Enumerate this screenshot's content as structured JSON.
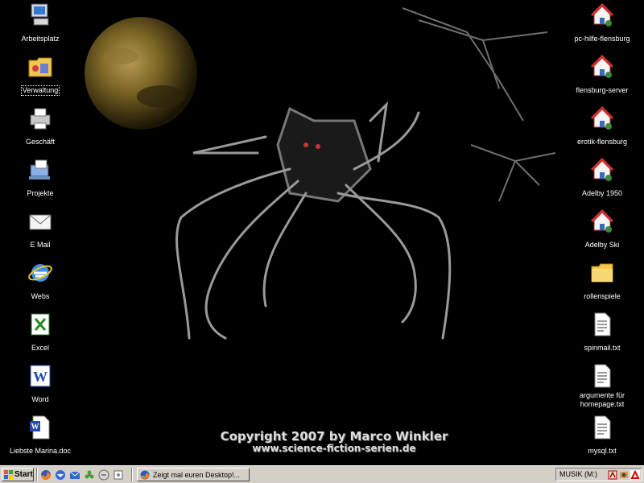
{
  "desktop": {
    "left_icons": [
      {
        "label": "Arbeitsplatz",
        "icon": "my-computer-icon"
      },
      {
        "label": "Verwaltung",
        "icon": "control-panel-folder-icon",
        "selected": true
      },
      {
        "label": "Geschäft",
        "icon": "printer-icon"
      },
      {
        "label": "Projekte",
        "icon": "projects-icon"
      },
      {
        "label": "E Mail",
        "icon": "email-envelope-icon"
      },
      {
        "label": "Webs",
        "icon": "internet-explorer-icon"
      },
      {
        "label": "Excel",
        "icon": "excel-icon"
      },
      {
        "label": "Word",
        "icon": "word-icon"
      },
      {
        "label": "Liebste Marina.doc",
        "icon": "word-document-icon"
      }
    ],
    "right_icons": [
      {
        "label": "pc-hilfe-flensburg",
        "icon": "network-home-icon"
      },
      {
        "label": "flensburg-server",
        "icon": "network-home-icon"
      },
      {
        "label": "erotik-flensburg",
        "icon": "network-home-icon"
      },
      {
        "label": "Adelby 1950",
        "icon": "network-home-icon"
      },
      {
        "label": "Adelby Ski",
        "icon": "network-home-icon"
      },
      {
        "label": "rollenspiele",
        "icon": "folder-icon"
      },
      {
        "label": "spinmail.txt",
        "icon": "text-file-icon"
      },
      {
        "label": "argumente für homepage.txt",
        "icon": "text-file-icon"
      },
      {
        "label": "mysql.txt",
        "icon": "text-file-icon"
      }
    ]
  },
  "wallpaper": {
    "copyright_line": "Copyright 2007 by Marco Winkler",
    "website_line": "www.science-fiction-serien.de"
  },
  "taskbar": {
    "start_label": "Start",
    "quick_launch": [
      "firefox-icon",
      "thunderbird-icon",
      "mail-icon",
      "icq-icon",
      "ie-icon",
      "media-icon"
    ],
    "task_button_label": "Zeigt mal euren Desktop!...",
    "tray_label": "MUSIK (M:)",
    "tray_icons": [
      "tray-app-icon",
      "tray-tool-icon",
      "tray-antivirus-icon"
    ]
  },
  "colors": {
    "desktop_bg": "#000000",
    "taskbar_bg": "#d4d0c8",
    "text": "#ffffff"
  }
}
